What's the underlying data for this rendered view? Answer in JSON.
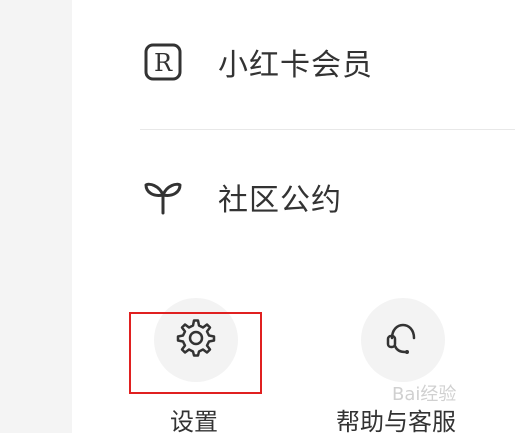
{
  "menu": {
    "member": {
      "label": "小红卡会员",
      "icon": "r-badge-icon",
      "icon_letter": "R"
    },
    "community": {
      "label": "社区公约",
      "icon": "sprout-icon"
    }
  },
  "tools": {
    "settings": {
      "label": "设置",
      "icon": "gear-icon"
    },
    "help": {
      "label": "帮助与客服",
      "icon": "headset-icon"
    }
  },
  "watermark": {
    "text": "Bai经验"
  },
  "colors": {
    "highlight": "#e02020",
    "text": "#333333",
    "icon_bg": "#f3f3f3",
    "left_strip": "#f4f4f4"
  }
}
